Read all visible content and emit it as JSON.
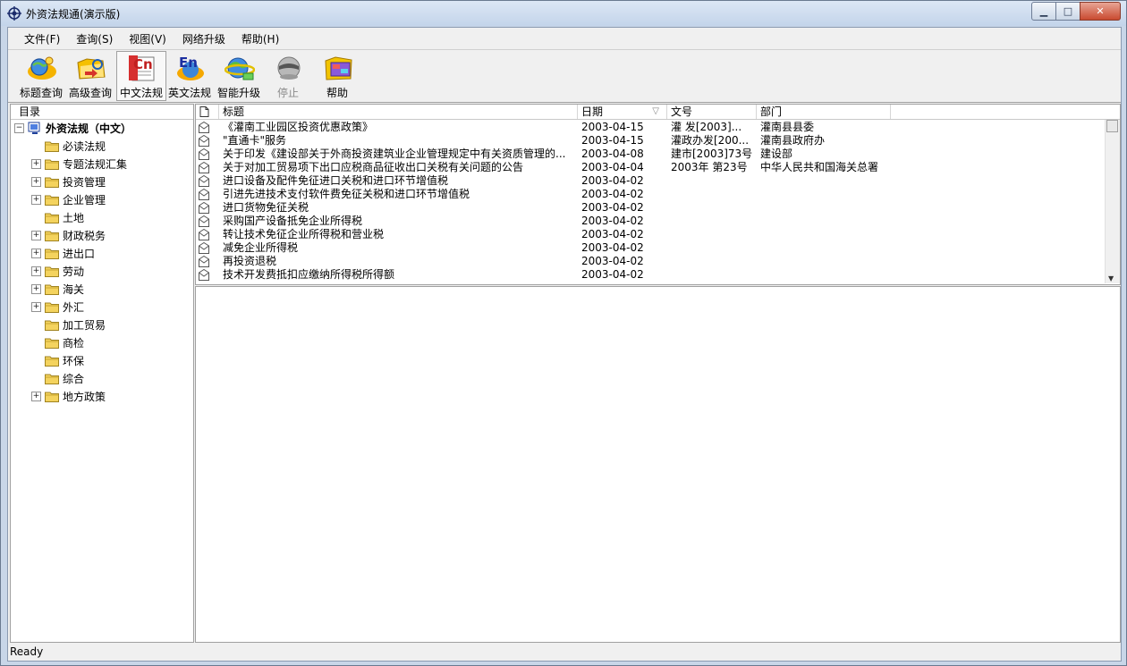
{
  "window": {
    "title": "外资法规通(演示版)",
    "min": "▁",
    "max": "□",
    "close": "✕"
  },
  "menu": [
    {
      "label": "文件(F)"
    },
    {
      "label": "查询(S)"
    },
    {
      "label": "视图(V)"
    },
    {
      "label": "网络升级"
    },
    {
      "label": "帮助(H)"
    }
  ],
  "toolbar": [
    {
      "label": "标题查询",
      "icon": "globe-search-icon",
      "pressed": false,
      "enabled": true
    },
    {
      "label": "高级查询",
      "icon": "folder-search-icon",
      "pressed": false,
      "enabled": true
    },
    {
      "label": "中文法规",
      "icon": "cn-book-icon",
      "pressed": true,
      "enabled": true
    },
    {
      "label": "英文法规",
      "icon": "en-book-icon",
      "pressed": false,
      "enabled": true
    },
    {
      "label": "智能升级",
      "icon": "globe-upgrade-icon",
      "pressed": false,
      "enabled": true
    },
    {
      "label": "停止",
      "icon": "stop-icon",
      "pressed": false,
      "enabled": false
    },
    {
      "label": "帮助",
      "icon": "help-book-icon",
      "pressed": false,
      "enabled": true
    }
  ],
  "tree": {
    "header": "目录",
    "root": {
      "label": "外资法规（中文）",
      "expanded": true
    },
    "items": [
      {
        "label": "必读法规",
        "expandable": false
      },
      {
        "label": "专题法规汇集",
        "expandable": true
      },
      {
        "label": "投资管理",
        "expandable": true
      },
      {
        "label": "企业管理",
        "expandable": true
      },
      {
        "label": "土地",
        "expandable": false
      },
      {
        "label": "财政税务",
        "expandable": true
      },
      {
        "label": "进出口",
        "expandable": true
      },
      {
        "label": "劳动",
        "expandable": true
      },
      {
        "label": "海关",
        "expandable": true
      },
      {
        "label": "外汇",
        "expandable": true
      },
      {
        "label": "加工贸易",
        "expandable": false
      },
      {
        "label": "商检",
        "expandable": false
      },
      {
        "label": "环保",
        "expandable": false
      },
      {
        "label": "综合",
        "expandable": false
      },
      {
        "label": "地方政策",
        "expandable": true
      }
    ],
    "expand_glyph": "+",
    "collapse_glyph": "−"
  },
  "list": {
    "columns": [
      "标题",
      "日期",
      "文号",
      "部门"
    ],
    "sort_glyph": "▽",
    "rows": [
      {
        "title": "《灌南工业园区投资优惠政策》",
        "date": "2003-04-15",
        "number": "灌  发[2003]...",
        "dept": "灌南县县委"
      },
      {
        "title": "\"直通卡\"服务",
        "date": "2003-04-15",
        "number": "灌政办发[200...",
        "dept": "灌南县政府办"
      },
      {
        "title": "关于印发《建设部关于外商投资建筑业企业管理规定中有关资质管理的...",
        "date": "2003-04-08",
        "number": "建市[2003]73号",
        "dept": "建设部"
      },
      {
        "title": "关于对加工贸易项下出口应税商品征收出口关税有关问题的公告",
        "date": "2003-04-04",
        "number": "2003年 第23号",
        "dept": "中华人民共和国海关总署"
      },
      {
        "title": "进口设备及配件免征进口关税和进口环节增值税",
        "date": "2003-04-02",
        "number": "",
        "dept": ""
      },
      {
        "title": "引进先进技术支付软件费免征关税和进口环节增值税",
        "date": "2003-04-02",
        "number": "",
        "dept": ""
      },
      {
        "title": "进口货物免征关税",
        "date": "2003-04-02",
        "number": "",
        "dept": ""
      },
      {
        "title": "采购国产设备抵免企业所得税",
        "date": "2003-04-02",
        "number": "",
        "dept": ""
      },
      {
        "title": "转让技术免征企业所得税和营业税",
        "date": "2003-04-02",
        "number": "",
        "dept": ""
      },
      {
        "title": "减免企业所得税",
        "date": "2003-04-02",
        "number": "",
        "dept": ""
      },
      {
        "title": "再投资退税",
        "date": "2003-04-02",
        "number": "",
        "dept": ""
      },
      {
        "title": "技术开发费抵扣应缴纳所得税所得额",
        "date": "2003-04-02",
        "number": "",
        "dept": ""
      }
    ],
    "scroll_up": "▲",
    "scroll_down": "▼"
  },
  "status": "Ready"
}
